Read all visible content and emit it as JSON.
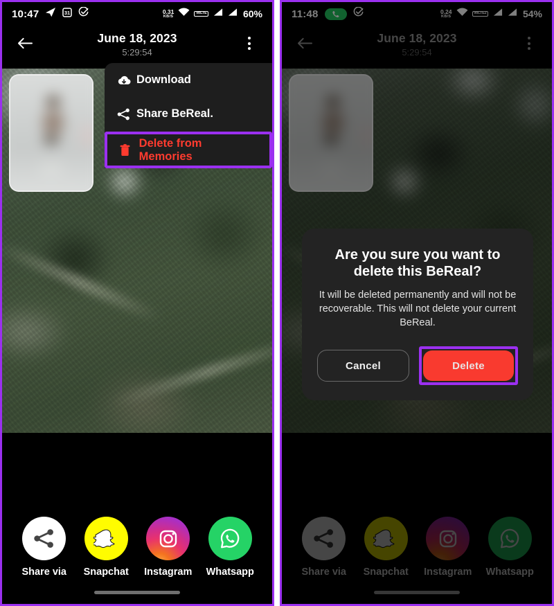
{
  "left_panel": {
    "status_bar": {
      "time": "10:47",
      "icons": [
        "telegram-icon",
        "calendar-icon",
        "check-circle-icon"
      ],
      "data_rate_value": "0.31",
      "data_rate_unit": "KB/S",
      "network_badge": "VoLTE",
      "battery": "60%"
    },
    "header": {
      "title": "June 18, 2023",
      "subtitle": "5:29:54"
    },
    "menu": {
      "items": [
        {
          "label": "Download",
          "icon": "cloud-download-icon",
          "danger": false
        },
        {
          "label": "Share BeReal.",
          "icon": "share-icon",
          "danger": false
        },
        {
          "label": "Delete from Memories",
          "icon": "trash-icon",
          "danger": true
        }
      ],
      "highlighted_item": "Delete from Memories",
      "highlight_color": "#9b30f0",
      "danger_color": "#ff3b2f"
    },
    "share_row": [
      {
        "label": "Share via",
        "icon": "share-icon"
      },
      {
        "label": "Snapchat",
        "icon": "snapchat-ghost-icon"
      },
      {
        "label": "Instagram",
        "icon": "instagram-camera-icon"
      },
      {
        "label": "Whatsapp",
        "icon": "whatsapp-icon"
      }
    ]
  },
  "right_panel": {
    "status_bar": {
      "time": "11:48",
      "icons": [
        "phone-call-pill-icon",
        "check-circle-icon"
      ],
      "data_rate_value": "0.24",
      "data_rate_unit": "KB/S",
      "network_badge": "VoLTE2",
      "battery": "54%"
    },
    "header": {
      "title": "June 18, 2023",
      "subtitle": "5:29:54"
    },
    "dialog": {
      "title": "Are you sure you want to delete this BeReal?",
      "body": "It will be deleted permanently and will not be recoverable. This will not delete your current BeReal.",
      "cancel_label": "Cancel",
      "delete_label": "Delete",
      "delete_color": "#f93a2f",
      "highlight_color": "#9b30f0"
    },
    "share_row": [
      {
        "label": "Share via",
        "icon": "share-icon"
      },
      {
        "label": "Snapchat",
        "icon": "snapchat-ghost-icon"
      },
      {
        "label": "Instagram",
        "icon": "instagram-camera-icon"
      },
      {
        "label": "Whatsapp",
        "icon": "whatsapp-icon"
      }
    ]
  }
}
